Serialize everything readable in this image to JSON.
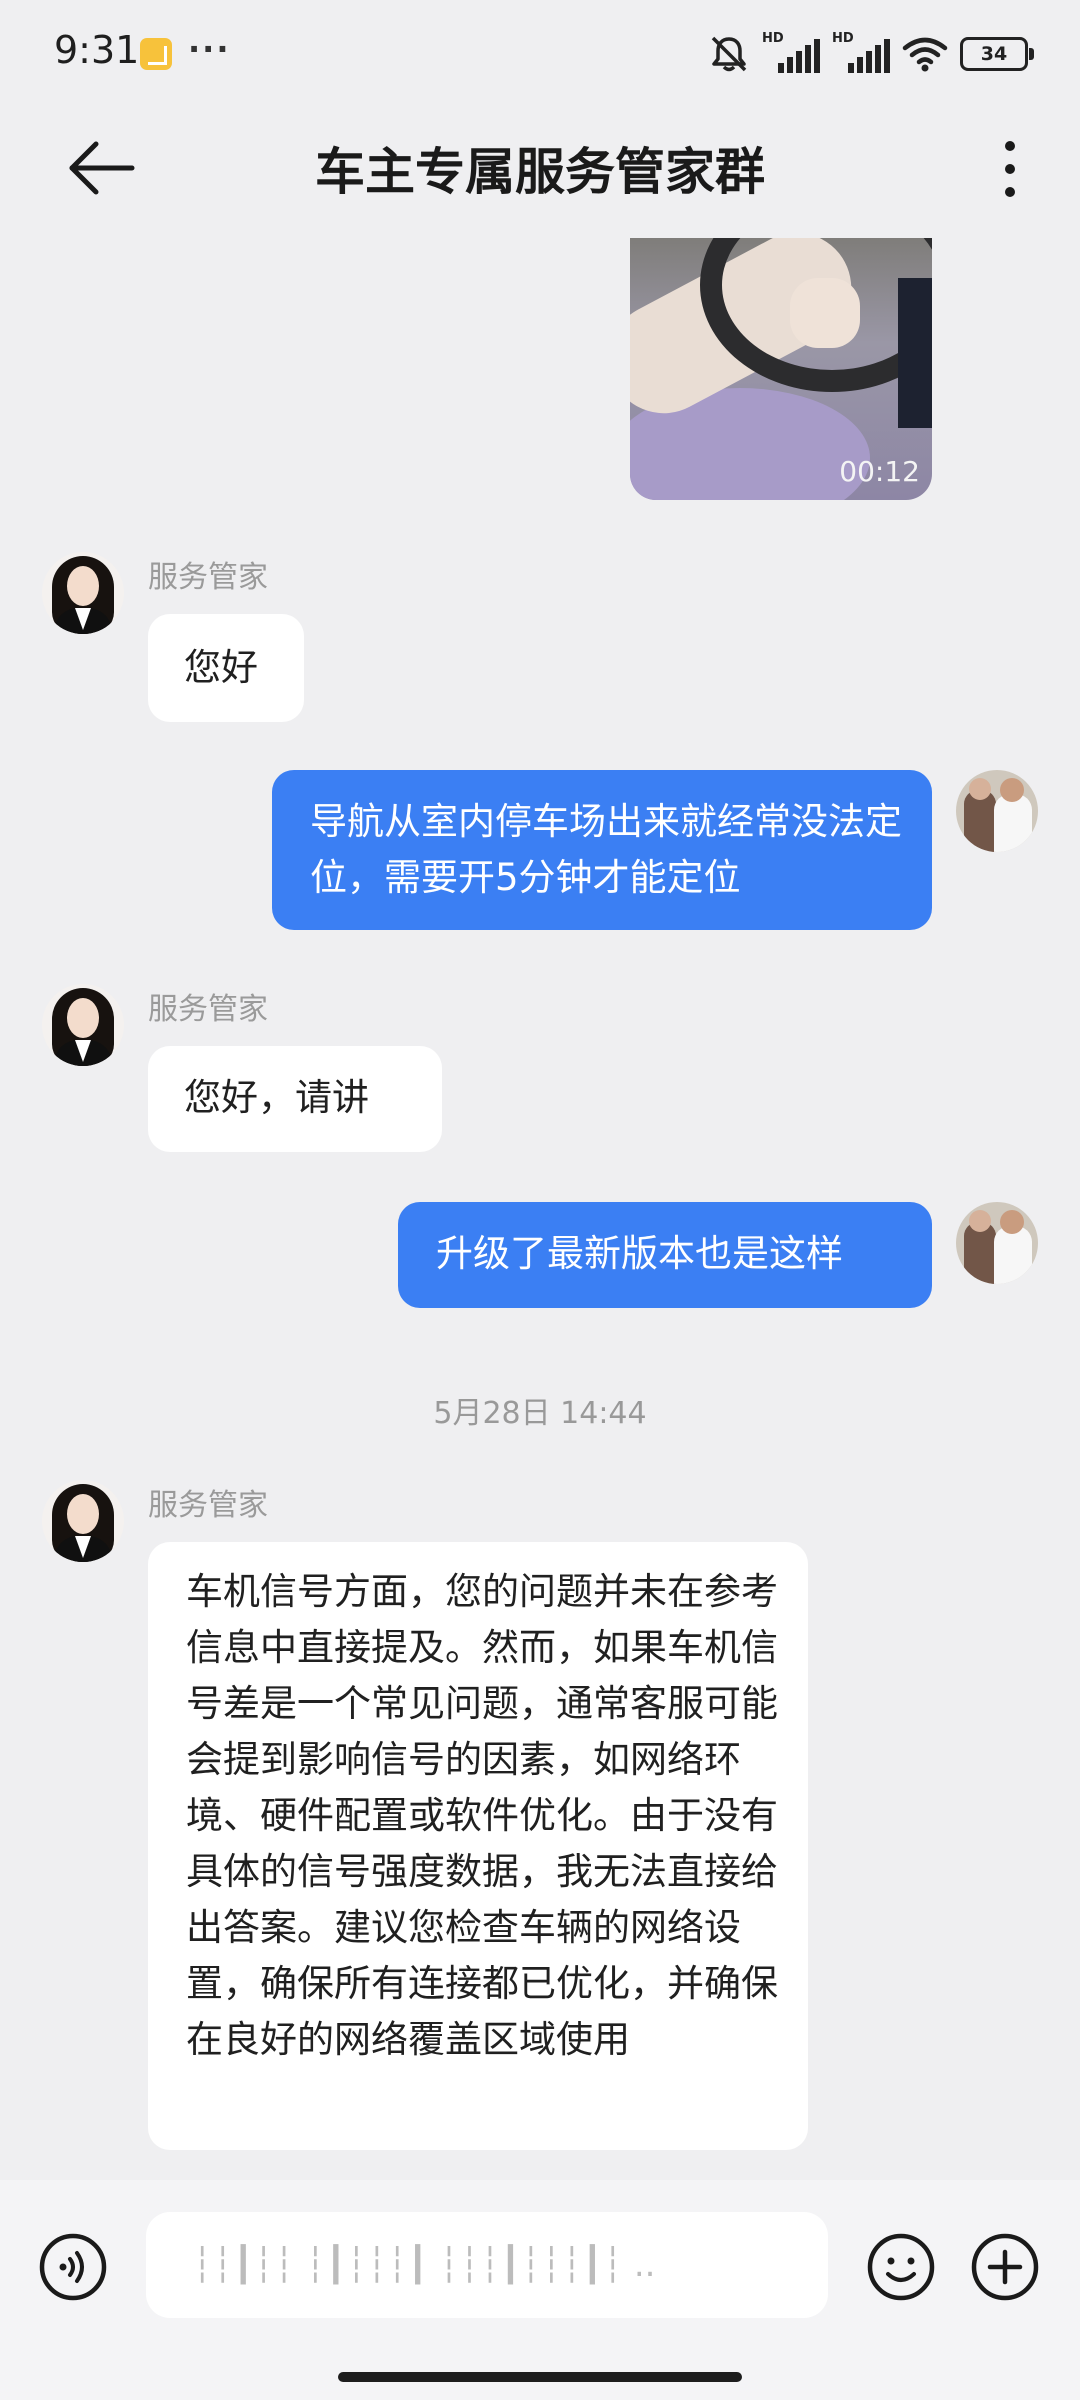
{
  "status_bar": {
    "time": "9:31",
    "more": "···",
    "signal1_label": "HD",
    "signal2_label": "HD",
    "battery": "34"
  },
  "header": {
    "title": "车主专属服务管家群"
  },
  "messages": {
    "video_duration": "00:12",
    "agent_name": "服务管家",
    "m1": "您好",
    "m2": "导航从室内停车场出来就经常没法定位，需要开5分钟才能定位",
    "m3": "您好，请讲",
    "m4": "升级了最新版本也是这样",
    "timestamp": "5月28日 14:44",
    "m5": "车机信号方面，您的问题并未在参考信息中直接提及。然而，如果车机信号差是一个常见问题，通常客服可能会提到影响信号的因素，如网络环境、硬件配置或软件优化。由于没有具体的信号强度数据，我无法直接给出答案。建议您检查车辆的网络设置，确保所有连接都已优化，并确保在良好的网络覆盖区域使用"
  },
  "input": {
    "placeholder": "┆┆┃┆┆ ┆┃┆┆┆┃ ┆┆┆┃┆┆┆┃┆ .."
  }
}
